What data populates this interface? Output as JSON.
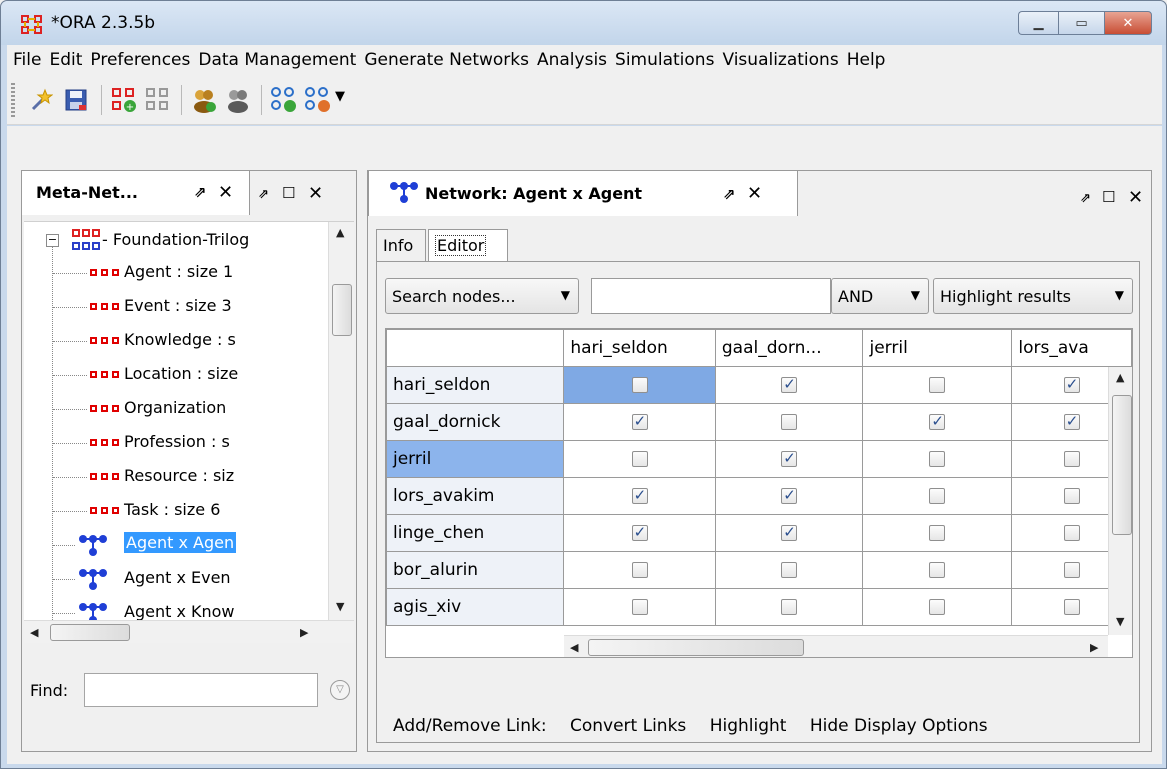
{
  "window": {
    "title": "*ORA 2.3.5b"
  },
  "menu": [
    "File",
    "Edit",
    "Preferences",
    "Data Management",
    "Generate Networks",
    "Analysis",
    "Simulations",
    "Visualizations",
    "Help"
  ],
  "toolbar": {
    "icons": [
      "wizard-icon",
      "save-icon",
      "add-nodeset-icon",
      "remove-nodeset-icon",
      "add-agent-icon",
      "remove-agent-icon",
      "add-network-icon",
      "remove-network-icon",
      "dropdown-icon"
    ]
  },
  "left_panel": {
    "tab_label": "Meta-Net...",
    "root": "- Foundation-Trilog",
    "items": [
      {
        "label": "Agent : size 1",
        "kind": "nodeset",
        "selected": false
      },
      {
        "label": "Event : size 3",
        "kind": "nodeset",
        "selected": false
      },
      {
        "label": "Knowledge : s",
        "kind": "nodeset",
        "selected": false
      },
      {
        "label": "Location : size",
        "kind": "nodeset",
        "selected": false
      },
      {
        "label": "Organization",
        "kind": "nodeset",
        "selected": false
      },
      {
        "label": "Profession : s",
        "kind": "nodeset",
        "selected": false
      },
      {
        "label": "Resource : siz",
        "kind": "nodeset",
        "selected": false
      },
      {
        "label": "Task : size 6",
        "kind": "nodeset",
        "selected": false
      },
      {
        "label": "Agent x Agen",
        "kind": "network",
        "selected": true
      },
      {
        "label": "Agent x Even",
        "kind": "network",
        "selected": false
      },
      {
        "label": "Agent x Know",
        "kind": "network",
        "selected": false
      }
    ],
    "find_label": "Find:",
    "find_value": ""
  },
  "right_panel": {
    "tab_label": "Network: Agent x Agent",
    "subtabs": [
      "Info",
      "Editor"
    ],
    "active_subtab": "Editor",
    "search_combo": "Search nodes...",
    "search_value": "",
    "logic_combo": "AND",
    "highlight_combo": "Highlight results",
    "columns": [
      "hari_seldon",
      "gaal_dorn...",
      "jerril",
      "lors_ava"
    ],
    "rows": [
      {
        "name": "hari_seldon",
        "cells": [
          false,
          true,
          false,
          true
        ]
      },
      {
        "name": "gaal_dornick",
        "cells": [
          true,
          false,
          true,
          true
        ]
      },
      {
        "name": "jerril",
        "cells": [
          false,
          true,
          false,
          false
        ]
      },
      {
        "name": "lors_avakim",
        "cells": [
          true,
          true,
          false,
          false
        ]
      },
      {
        "name": "linge_chen",
        "cells": [
          true,
          true,
          false,
          false
        ]
      },
      {
        "name": "bor_alurin",
        "cells": [
          false,
          false,
          false,
          false
        ]
      },
      {
        "name": "agis_xiv",
        "cells": [
          false,
          false,
          false,
          false
        ]
      }
    ],
    "bottom_links": [
      "Add/Remove Link:",
      "Convert Links",
      "Highlight",
      "Hide Display Options"
    ]
  },
  "colors": {
    "selection": "#3399ff",
    "row_selected": "#8cb4ec",
    "cell_selected": "#7fa9e4"
  }
}
